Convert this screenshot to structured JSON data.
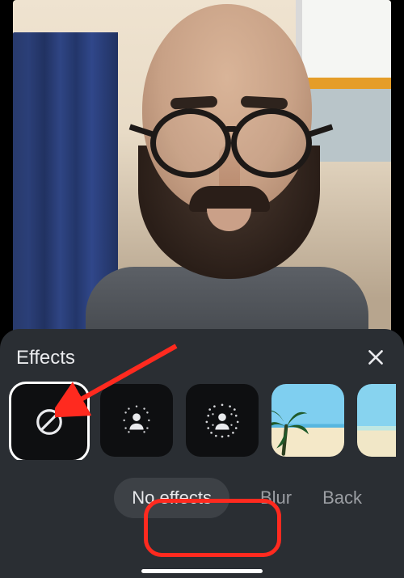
{
  "panel": {
    "title": "Effects",
    "close_icon": "close"
  },
  "effects": {
    "items": [
      {
        "id": "none",
        "icon": "prohibit-icon",
        "selected": true
      },
      {
        "id": "blur-light",
        "icon": "person-blur-light",
        "selected": false
      },
      {
        "id": "blur-strong",
        "icon": "person-blur-strong",
        "selected": false
      },
      {
        "id": "beach-1",
        "icon": "bg-beach-palm",
        "selected": false
      },
      {
        "id": "beach-2",
        "icon": "bg-beach",
        "selected": false
      }
    ]
  },
  "labels": {
    "items": [
      {
        "id": "none",
        "text": "No effects",
        "active": true
      },
      {
        "id": "blur",
        "text": "Blur",
        "active": false
      },
      {
        "id": "background",
        "text": "Back",
        "active": false
      }
    ]
  },
  "annotations": {
    "arrow_target": "effect-none",
    "highlight_target": "label-no-effects"
  }
}
